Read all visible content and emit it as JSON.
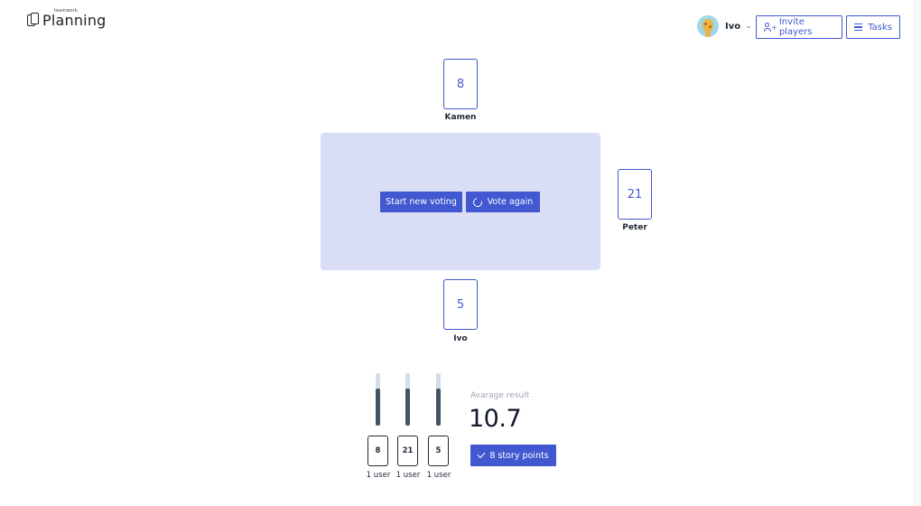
{
  "app": {
    "logo_small": "teamwork.",
    "logo_main": "Planning"
  },
  "header": {
    "user_name": "Ivo",
    "invite_label": "Invite players",
    "tasks_label": "Tasks"
  },
  "table": {
    "start_label": "Start new voting",
    "again_label": "Vote again"
  },
  "players": [
    {
      "name": "Kamen",
      "vote": "8"
    },
    {
      "name": "Peter",
      "vote": "21"
    },
    {
      "name": "Ivo",
      "vote": "5"
    }
  ],
  "results": {
    "distribution": [
      {
        "card": "8",
        "users": "1 user",
        "share": 0.7
      },
      {
        "card": "21",
        "users": "1 user",
        "share": 0.7
      },
      {
        "card": "5",
        "users": "1 user",
        "share": 0.7
      }
    ],
    "average_label": "Avarage result",
    "average_value": "10.7",
    "story_points_label": "8 story points"
  },
  "colors": {
    "accent": "#4158d0",
    "table_bg": "#d9def6",
    "bar_fill": "#435466",
    "bar_track": "#d5dde8"
  },
  "icons": {
    "logo": "cards-logo-icon",
    "invite": "add-person-icon",
    "tasks": "list-icon",
    "vote_again": "refresh-icon",
    "story_points": "check-icon",
    "user_menu": "chevron-down-icon"
  }
}
